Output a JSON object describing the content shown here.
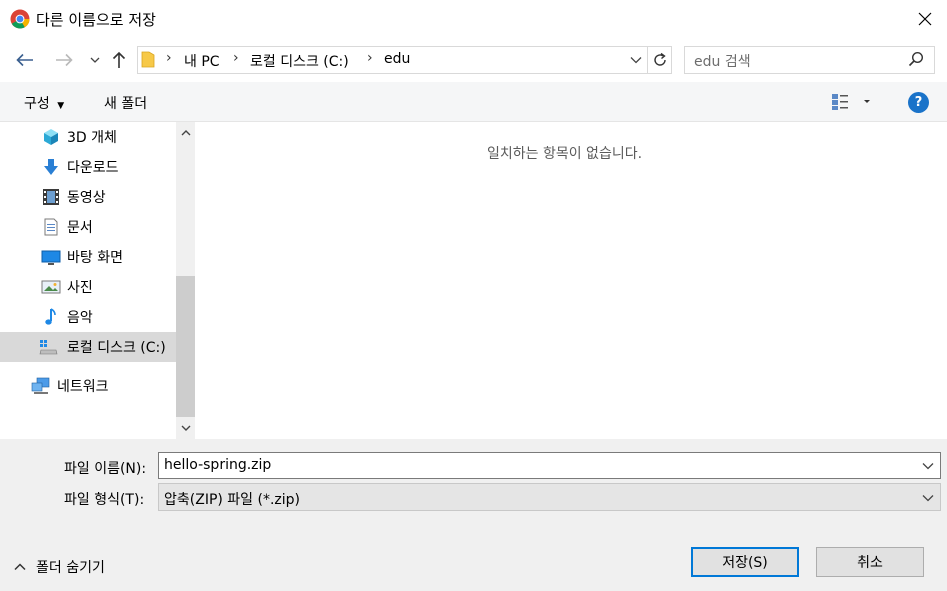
{
  "window": {
    "title": "다른 이름으로 저장"
  },
  "breadcrumbs": [
    "내 PC",
    "로컬 디스크 (C:)",
    "edu"
  ],
  "search": {
    "placeholder": "edu 검색"
  },
  "toolbar": {
    "organize_label": "구성",
    "new_folder_label": "새 폴더",
    "help_label": "?"
  },
  "sidebar": {
    "items": [
      {
        "label": "3D 개체",
        "icon": "cube-icon"
      },
      {
        "label": "다운로드",
        "icon": "download-arrow-icon"
      },
      {
        "label": "동영상",
        "icon": "film-icon"
      },
      {
        "label": "문서",
        "icon": "document-icon"
      },
      {
        "label": "바탕 화면",
        "icon": "desktop-icon"
      },
      {
        "label": "사진",
        "icon": "picture-icon"
      },
      {
        "label": "음악",
        "icon": "music-note-icon"
      },
      {
        "label": "로컬 디스크 (C:)",
        "icon": "drive-icon",
        "selected": true
      },
      {
        "label": "네트워크",
        "icon": "network-icon"
      }
    ]
  },
  "content": {
    "empty_message": "일치하는 항목이 없습니다."
  },
  "form": {
    "filename_label": "파일 이름(N):",
    "filename_value": "hello-spring.zip",
    "filetype_label": "파일 형식(T):",
    "filetype_value": "압축(ZIP) 파일 (*.zip)"
  },
  "footer": {
    "hide_folders_label": "폴더 숨기기",
    "save_label": "저장(S)",
    "cancel_label": "취소"
  },
  "colors": {
    "accent": "#0078d7",
    "help": "#1a73c9",
    "selected_bg": "#d9d9d9"
  }
}
